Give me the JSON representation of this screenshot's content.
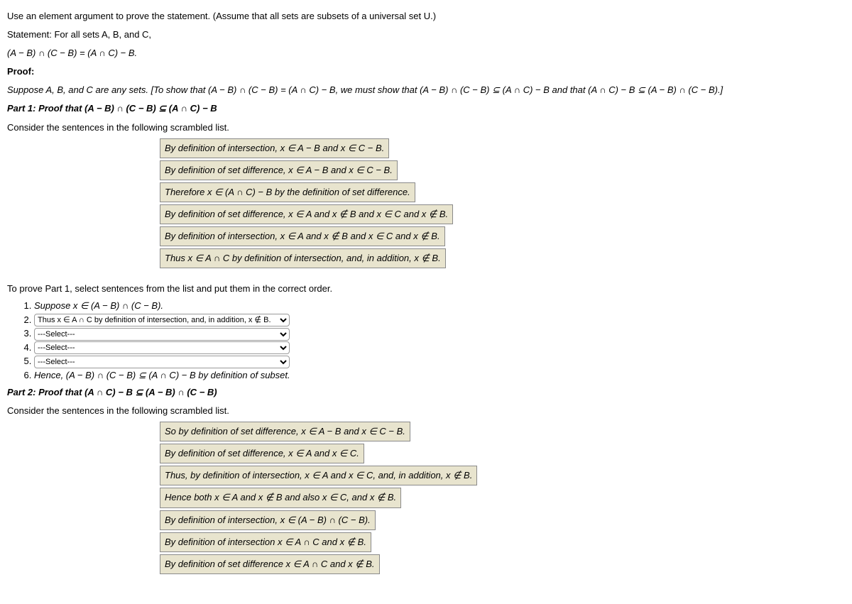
{
  "intro": "Use an element argument to prove the statement. (Assume that all sets are subsets of a universal set U.)",
  "statement_label": "Statement: For all sets A, B, and C,",
  "statement_eq": "(A − B) ∩ (C − B) = (A ∩ C) − B.",
  "proof_label": "Proof:",
  "proof_intro": "Suppose A, B, and C are any sets. [To show that (A − B) ∩ (C − B) = (A ∩ C) − B, we must show that (A − B) ∩ (C − B) ⊆ (A ∩ C) − B and that (A ∩ C) − B ⊆ (A − B) ∩ (C − B).]",
  "part1_heading": "Part 1: Proof that (A − B) ∩ (C − B) ⊆ (A ∩ C) − B",
  "consider1": "Consider the sentences in the following scrambled list.",
  "part1_boxes": [
    "By definition of intersection, x ∈ A − B and x ∈ C − B.",
    "By definition of set difference, x ∈ A − B and x ∈ C − B.",
    "Therefore x ∈ (A ∩ C) − B by the definition of set difference.",
    "By definition of set difference, x ∈ A and x ∉ B and x ∈ C and x ∉ B.",
    "By definition of intersection, x ∈ A and x ∉ B and x ∈ C and x ∉ B.",
    "Thus x ∈ A ∩ C by definition of intersection, and, in addition, x ∉ B."
  ],
  "part1_order_intro": "To prove Part 1, select sentences from the list and put them in the correct order.",
  "steps": {
    "s1": "Suppose x ∈ (A − B) ∩ (C − B).",
    "s6": "Hence, (A − B) ∩ (C − B) ⊆ (A ∩ C) − B by definition of subset."
  },
  "select": {
    "options": [
      "---Select---",
      "By definition of intersection, x ∈ A − B and x ∈ C − B.",
      "By definition of set difference, x ∈ A − B and x ∈ C − B.",
      "Therefore x ∈ (A ∩ C) − B by the definition of set difference.",
      "By definition of set difference, x ∈ A and x ∉ B and x ∈ C and x ∉ B.",
      "By definition of intersection, x ∈ A and x ∉ B and x ∈ C and x ∉ B.",
      "Thus x ∈ A ∩ C by definition of intersection, and, in addition, x ∉ B."
    ],
    "step2_selected": "Thus x ∈ A ∩ C by definition of intersection, and, in addition, x ∉ B.",
    "step3_selected": "---Select---",
    "step4_selected": "---Select---",
    "step5_selected": "---Select---"
  },
  "part2_heading": "Part 2: Proof that (A ∩ C) − B ⊆ (A − B) ∩ (C − B)",
  "consider2": "Consider the sentences in the following scrambled list.",
  "part2_boxes": [
    "So by definition of set difference, x ∈ A − B and x ∈ C − B.",
    "By definition of set difference, x ∈ A and x ∈ C.",
    "Thus, by definition of intersection, x ∈ A and x ∈ C, and, in addition, x ∉ B.",
    "Hence both x ∈ A and x ∉ B and also x ∈ C, and x ∉ B.",
    "By definition of intersection, x ∈ (A − B) ∩ (C − B).",
    "By definition of intersection x ∈ A ∩ C and x ∉ B.",
    "By definition of set difference x ∈ A ∩ C and x ∉ B."
  ]
}
